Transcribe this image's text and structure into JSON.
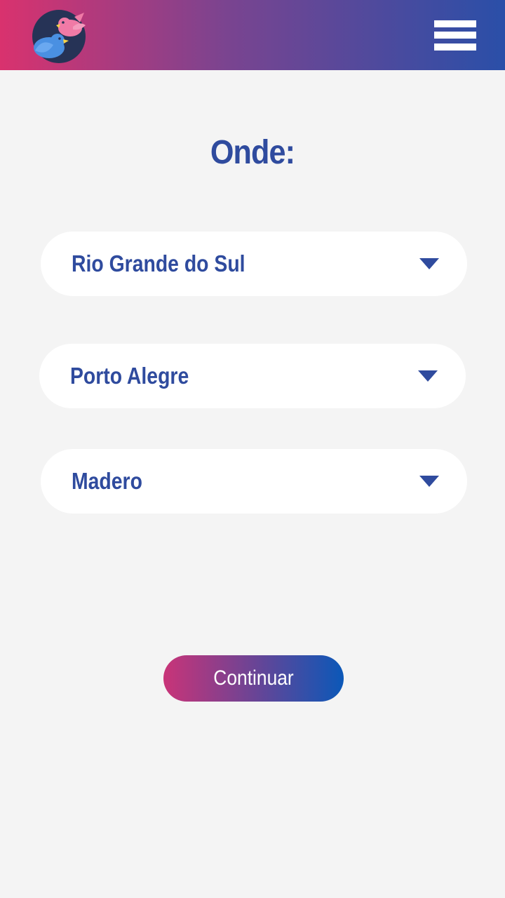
{
  "header": {
    "logo_icon": "two-birds-logo-icon",
    "menu_icon": "hamburger-menu-icon",
    "gradient": [
      "#d9326e",
      "#2a4fa8"
    ]
  },
  "main": {
    "title": "Onde:",
    "selects": [
      {
        "value": "Rio Grande do Sul",
        "icon": "chevron-down-icon"
      },
      {
        "value": "Porto Alegre",
        "icon": "chevron-down-icon"
      },
      {
        "value": "Madero",
        "icon": "chevron-down-icon"
      }
    ],
    "continue_label": "Continuar"
  },
  "colors": {
    "accent": "#2f4b9e",
    "background": "#f4f4f4",
    "button_gradient": [
      "#c93478",
      "#0b58b8"
    ]
  }
}
